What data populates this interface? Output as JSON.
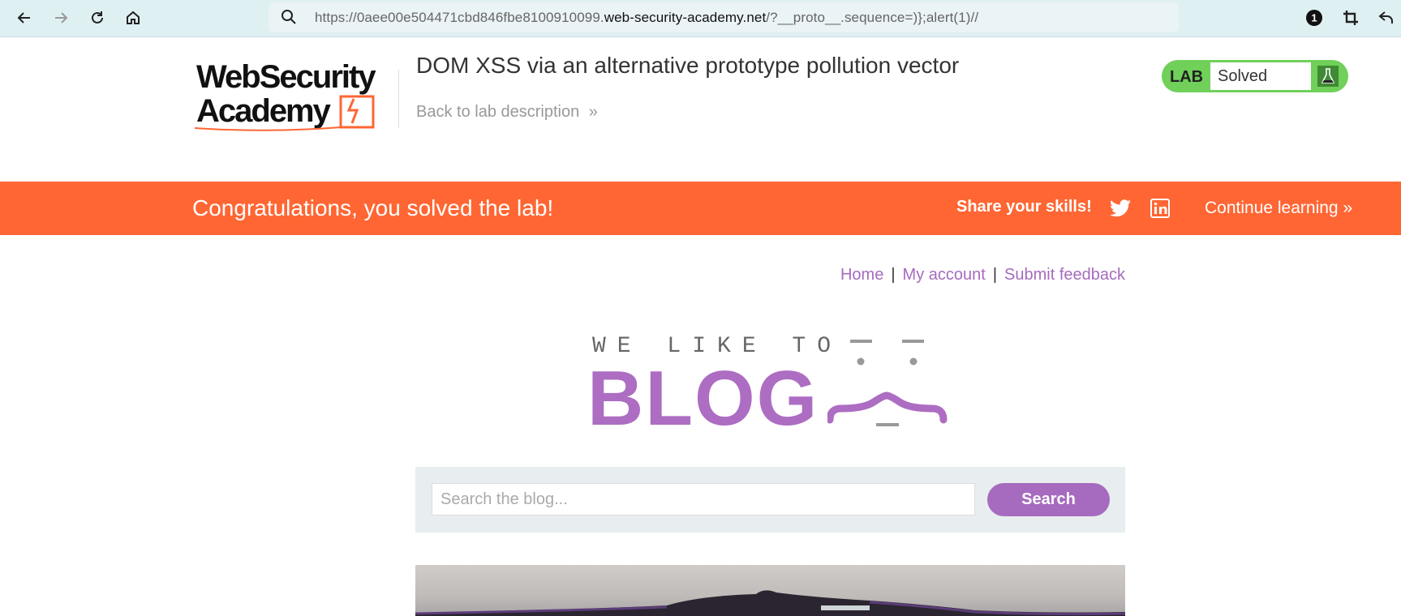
{
  "browser": {
    "url_prefix": "https://0aee00e504471cbd846fbe8100910099.",
    "url_host": "web-security-academy.net",
    "url_suffix": "/?__proto__.sequence=)};alert(1)//",
    "notification_count": "1"
  },
  "academy": {
    "logo_line1": "WebSecurity",
    "logo_line2": "Academy",
    "lab_title": "DOM XSS via an alternative prototype pollution vector",
    "back_link": "Back to lab description",
    "lab_badge": "LAB",
    "lab_status": "Solved",
    "accent_color": "#ff6633",
    "badge_color": "#70d05a"
  },
  "banner": {
    "congrats": "Congratulations, you solved the lab!",
    "share": "Share your skills!",
    "continue": "Continue learning"
  },
  "nav": {
    "home": "Home",
    "account": "My account",
    "feedback": "Submit feedback",
    "separator": "|"
  },
  "blog": {
    "tagline": "WE LIKE TO",
    "title": "BLOG",
    "brand_color": "#ad6dc2"
  },
  "search": {
    "placeholder": "Search the blog...",
    "button": "Search"
  },
  "icons": [
    "back-arrow-icon",
    "forward-arrow-icon",
    "reload-icon",
    "home-icon",
    "search-icon",
    "notification-icon",
    "crop-icon",
    "undo-icon",
    "flask-icon",
    "twitter-icon",
    "linkedin-icon",
    "chevron-right-double-icon"
  ]
}
